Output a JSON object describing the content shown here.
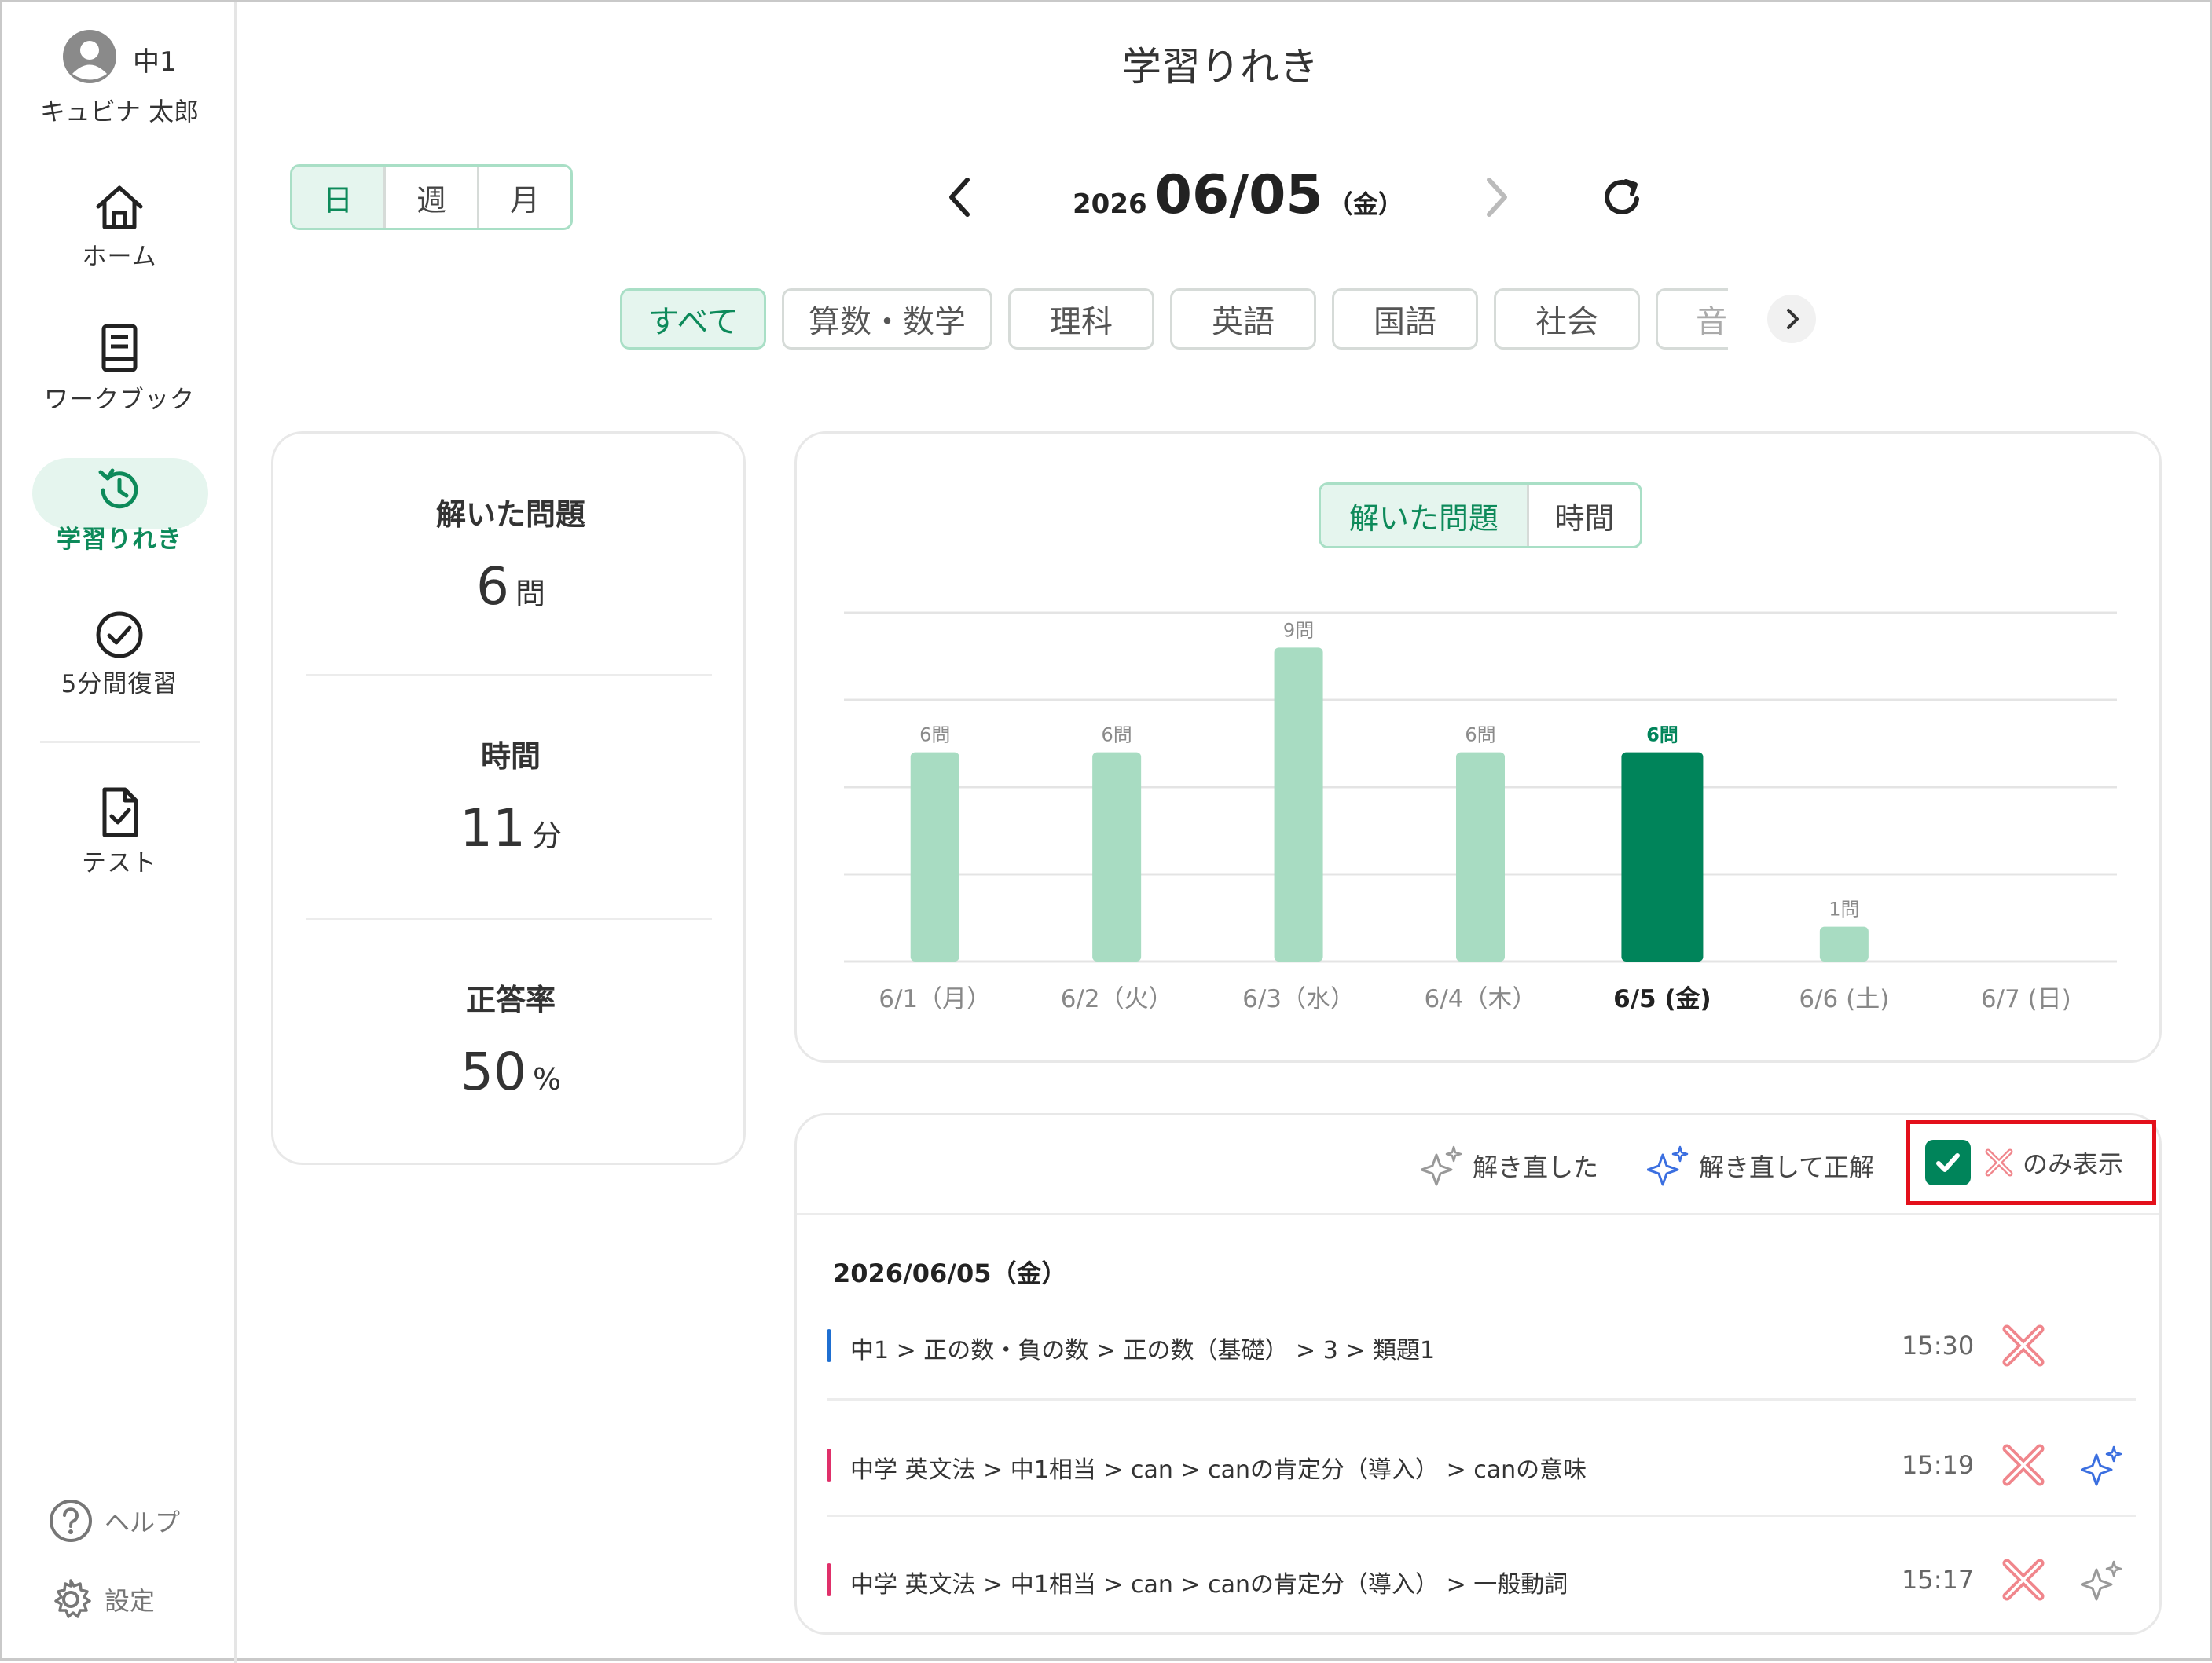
{
  "user": {
    "grade": "中1",
    "name": "キュビナ 太郎"
  },
  "nav": {
    "items": [
      {
        "label": "ホーム",
        "icon": "home-icon"
      },
      {
        "label": "ワークブック",
        "icon": "book-icon"
      },
      {
        "label": "学習りれき",
        "icon": "history-icon",
        "active": true
      },
      {
        "label": "5分間復習",
        "icon": "check-circle-icon"
      },
      {
        "label": "テスト",
        "icon": "test-doc-icon"
      }
    ],
    "help": "ヘルプ",
    "settings": "設定"
  },
  "page_title": "学習りれき",
  "period_tabs": [
    "日",
    "週",
    "月"
  ],
  "period_selected": "日",
  "date": {
    "year": "2026",
    "md": "06/05",
    "weekday": "（金）"
  },
  "subjects": [
    "すべて",
    "算数・数学",
    "理科",
    "英語",
    "国語",
    "社会",
    "音"
  ],
  "subject_selected": "すべて",
  "stats": [
    {
      "label": "解いた問題",
      "value": "6",
      "unit": "問"
    },
    {
      "label": "時間",
      "value": "11",
      "unit": "分"
    },
    {
      "label": "正答率",
      "value": "50",
      "unit": "%"
    }
  ],
  "chart_toggle": [
    "解いた問題",
    "時間"
  ],
  "chart_toggle_selected": "解いた問題",
  "chart_data": {
    "type": "bar",
    "categories": [
      "6/1（月）",
      "6/2（火）",
      "6/3（水）",
      "6/4（木）",
      "6/5 (金)",
      "6/6 (土)",
      "6/7 (日)"
    ],
    "values": [
      6,
      6,
      9,
      6,
      6,
      1,
      0
    ],
    "data_labels": [
      "6問",
      "6問",
      "9問",
      "6問",
      "6問",
      "1問",
      ""
    ],
    "highlight_index": 4,
    "ylim": [
      0,
      10
    ],
    "grid": true,
    "colors": {
      "bar": "#a8dcc2",
      "highlight": "#00845a"
    }
  },
  "filters": {
    "resolved": "解き直した",
    "resolved_correct": "解き直して正解",
    "wrong_only": "のみ表示",
    "wrong_only_checked": true
  },
  "history": {
    "date_heading": "2026/06/05（金）",
    "rows": [
      {
        "path": "中1 > 正の数・負の数 > 正の数（基礎） > 3 > 類題1",
        "time": "15:30",
        "result": "incorrect",
        "sparkle": "none",
        "color": "#1f6fd1"
      },
      {
        "path": "中学 英文法 > 中1相当 > can > canの肯定分（導入） > canの意味",
        "time": "15:19",
        "result": "incorrect",
        "sparkle": "correct",
        "color": "#e0306a"
      },
      {
        "path": "中学 英文法 > 中1相当 > can > canの肯定分（導入） > 一般動詞",
        "time": "15:17",
        "result": "incorrect",
        "sparkle": "retried",
        "color": "#e0306a"
      }
    ]
  }
}
